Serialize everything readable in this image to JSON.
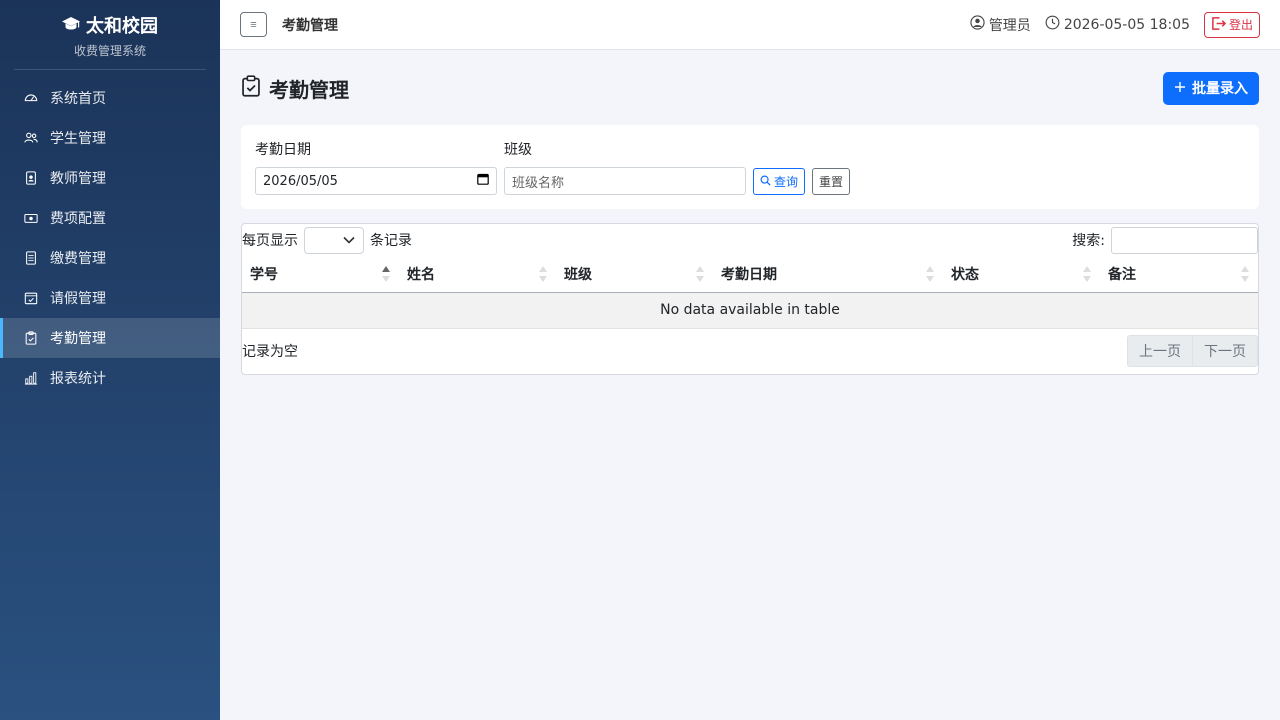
{
  "sidebar": {
    "brand_title": "太和校园",
    "brand_subtitle": "收费管理系统",
    "items": [
      {
        "label": "系统首页",
        "icon": "dashboard-icon"
      },
      {
        "label": "学生管理",
        "icon": "people-icon"
      },
      {
        "label": "教师管理",
        "icon": "person-badge-icon"
      },
      {
        "label": "费项配置",
        "icon": "cash-icon"
      },
      {
        "label": "缴费管理",
        "icon": "receipt-icon"
      },
      {
        "label": "请假管理",
        "icon": "calendar-check-icon"
      },
      {
        "label": "考勤管理",
        "icon": "clipboard-check-icon",
        "active": true
      },
      {
        "label": "报表统计",
        "icon": "bar-chart-icon"
      }
    ]
  },
  "topbar": {
    "toggle_label": "≡",
    "title": "考勤管理",
    "user": "管理员",
    "datetime": "2026-05-05 18:05",
    "logout_label": "登出"
  },
  "page": {
    "title": "考勤管理",
    "batch_button": "批量录入"
  },
  "filters": {
    "date_label": "考勤日期",
    "date_value": "2026/05/05",
    "class_label": "班级",
    "class_placeholder": "班级名称",
    "query_button": "查询",
    "reset_button": "重置"
  },
  "table": {
    "length_prefix": "每页显示",
    "length_suffix": "条记录",
    "search_label": "搜索:",
    "columns": [
      "学号",
      "姓名",
      "班级",
      "考勤日期",
      "状态",
      "备注"
    ],
    "empty_message": "No data available in table",
    "info": "记录为空",
    "prev": "上一页",
    "next": "下一页"
  },
  "colors": {
    "primary": "#0d6efd",
    "danger": "#dc3545",
    "sidebar_top": "#1b3358",
    "sidebar_bottom": "#2a5180",
    "active_border": "#4ab8ff"
  }
}
